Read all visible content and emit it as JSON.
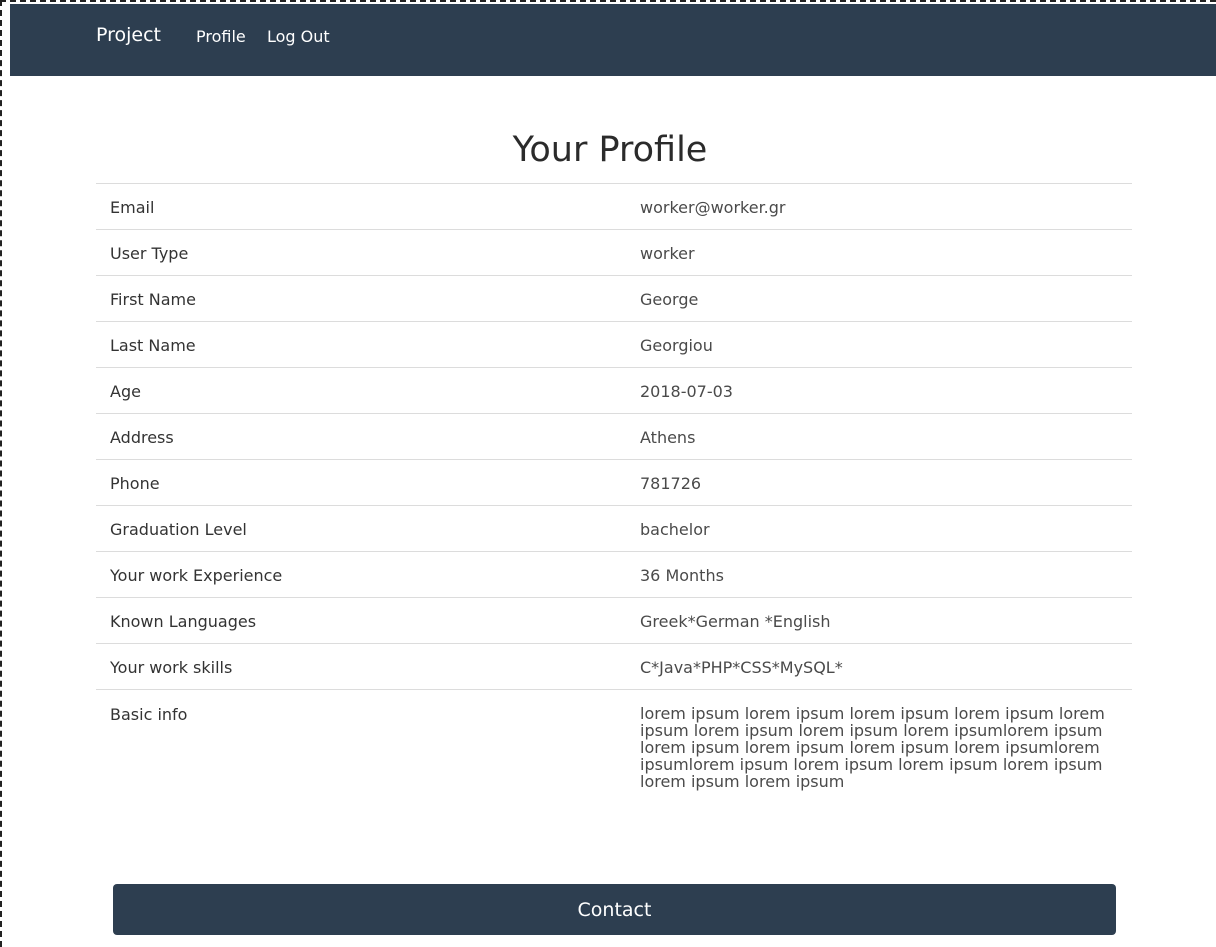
{
  "navbar": {
    "brand": "Project",
    "links": [
      "Profile",
      "Log Out"
    ]
  },
  "page": {
    "title": "Your Profile"
  },
  "profile": {
    "rows": [
      {
        "label": "Email",
        "value": "worker@worker.gr"
      },
      {
        "label": "User Type",
        "value": "worker"
      },
      {
        "label": "First Name",
        "value": "George"
      },
      {
        "label": "Last Name",
        "value": "Georgiou"
      },
      {
        "label": "Age",
        "value": "2018-07-03"
      },
      {
        "label": "Address",
        "value": "Athens"
      },
      {
        "label": "Phone",
        "value": "781726"
      },
      {
        "label": "Graduation Level",
        "value": "bachelor"
      },
      {
        "label": "Your work Experience",
        "value": "36 Months"
      },
      {
        "label": "Known Languages",
        "value": "Greek*German *English"
      },
      {
        "label": "Your work skills",
        "value": "C*Java*PHP*CSS*MySQL*"
      },
      {
        "label": "Basic info",
        "value": "lorem ipsum lorem ipsum lorem ipsum lorem ipsum lorem ipsum lorem ipsum lorem ipsum lorem ipsumlorem ipsum lorem ipsum lorem ipsum lorem ipsum lorem ipsumlorem ipsumlorem ipsum lorem ipsum lorem ipsum lorem ipsum lorem ipsum lorem ipsum"
      }
    ]
  },
  "actions": {
    "contact_label": "Contact"
  },
  "colors": {
    "navbar_bg": "#2d3e50",
    "button_bg": "#2d3e50",
    "divider": "#dcdcdc"
  }
}
